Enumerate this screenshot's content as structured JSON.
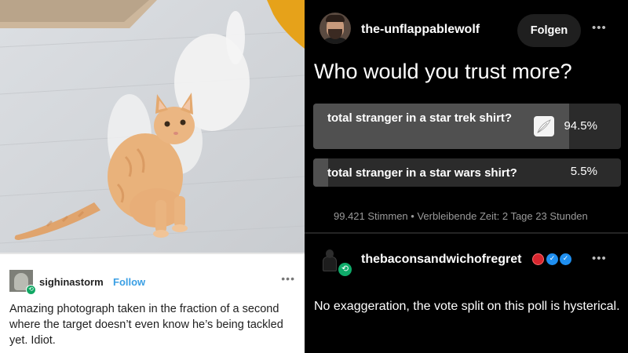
{
  "left_post": {
    "username": "sighinastorm",
    "follow_label": "Follow",
    "more_icon": "•••",
    "text": "Amazing photograph taken in the fraction of a second where the target doesn’t even know he’s being tackled yet.  Idiot."
  },
  "right_post": {
    "username": "the-unflappablewolf",
    "follow_label": "Folgen",
    "more_icon": "•••",
    "poll": {
      "question": "Who would you trust more?",
      "options": [
        {
          "label": "total stranger in a star trek shirt?",
          "percent_label": "94.5%",
          "percent": 94.5
        },
        {
          "label": "total stranger in a star wars shirt?",
          "percent_label": "5.5%",
          "percent": 5.5
        }
      ],
      "meta": "99.421 Stimmen • Verbleibende Zeit: 2 Tage 23 Stunden"
    }
  },
  "reblog_post": {
    "username": "thebaconsandwichofregret",
    "more_icon": "•••",
    "text": "No exaggeration, the vote split on this poll is hysterical."
  },
  "icons": {
    "reblog": "⟲",
    "check": "✓"
  },
  "colors": {
    "follow_blue": "#3a9fe4",
    "reblog_green": "#11a864",
    "poll_fill": "#505050",
    "poll_track": "#2b2b2b"
  }
}
